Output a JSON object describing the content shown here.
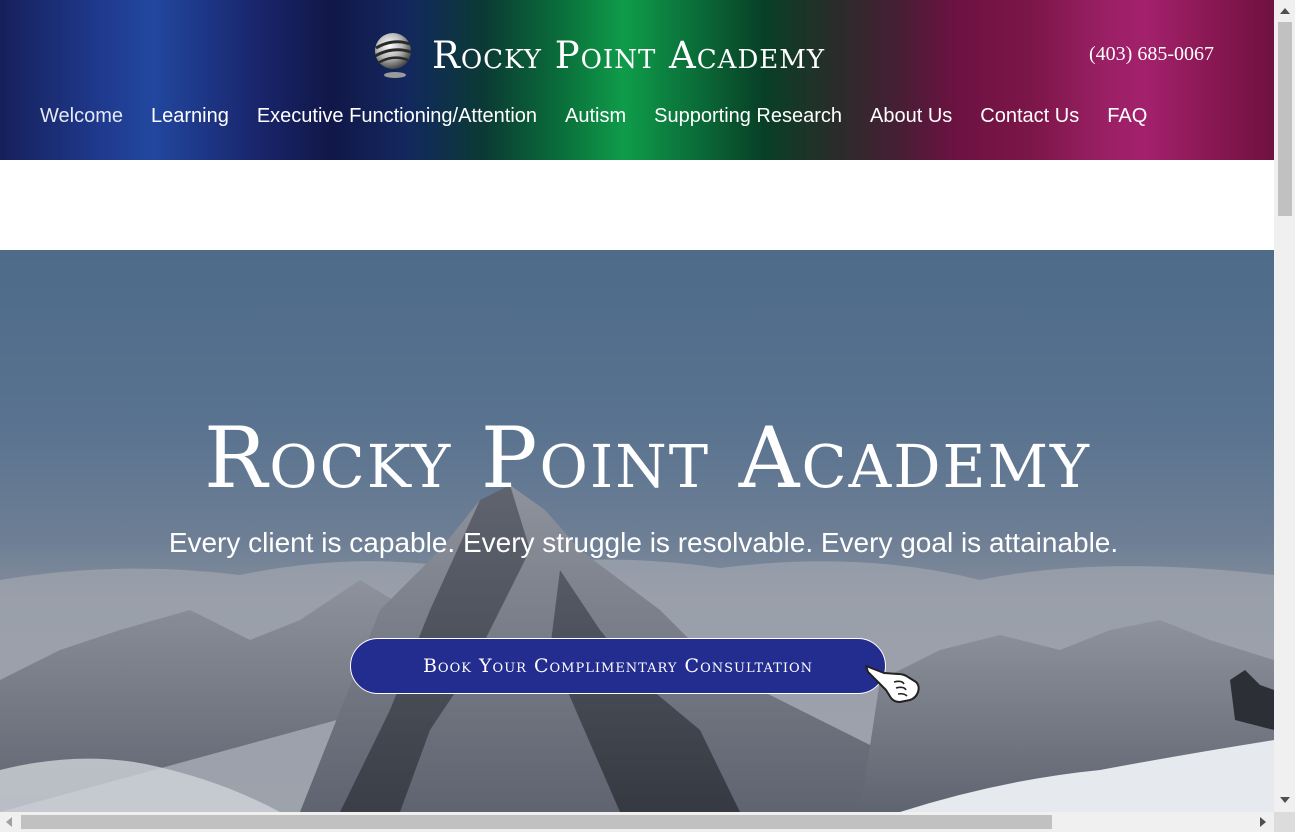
{
  "header": {
    "logo_text": "Rocky Point Academy",
    "logo_icon": "globe-logo-icon",
    "phone": "(403) 685-0067",
    "nav": [
      {
        "label": "Welcome"
      },
      {
        "label": "Learning"
      },
      {
        "label": "Executive Functioning/Attention"
      },
      {
        "label": "Autism"
      },
      {
        "label": "Supporting Research"
      },
      {
        "label": "About Us"
      },
      {
        "label": "Contact Us"
      },
      {
        "label": "FAQ"
      }
    ]
  },
  "hero": {
    "title": "Rocky Point Academy",
    "tagline": "Every client is capable. Every struggle is resolvable. Every goal is attainable.",
    "cta_label": "Book Your Complimentary Consultation",
    "cta_icon": "pointing-hand-icon",
    "background": "snowy-mountain-peaks"
  },
  "colors": {
    "cta_background": "#232c8f",
    "header_blue": "#22479f",
    "header_green": "#0f9c4a",
    "header_magenta": "#a3216c"
  }
}
